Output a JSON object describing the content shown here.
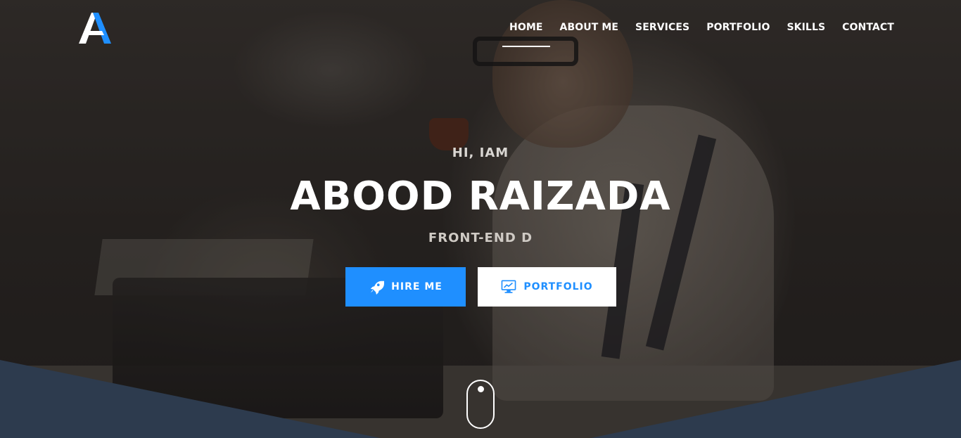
{
  "brand": {
    "logo_letter": "A",
    "logo_colors": {
      "light": "#ffffff",
      "accent": "#1f8fff"
    }
  },
  "nav": {
    "items": [
      {
        "label": "HOME",
        "active": true
      },
      {
        "label": "ABOUT ME",
        "active": false
      },
      {
        "label": "SERVICES",
        "active": false
      },
      {
        "label": "PORTFOLIO",
        "active": false
      },
      {
        "label": "SKILLS",
        "active": false
      },
      {
        "label": "CONTACT",
        "active": false
      }
    ]
  },
  "hero": {
    "greeting": "HI, IAM",
    "name": "ABOOD RAIZADA",
    "role": "FRONT-END D",
    "buttons": {
      "hire": {
        "label": "HIRE ME",
        "icon": "rocket-icon"
      },
      "portfolio": {
        "label": "PORTFOLIO",
        "icon": "monitor-chart-icon"
      }
    }
  },
  "scroll_indicator": {
    "icon": "mouse-scroll-icon"
  },
  "colors": {
    "accent": "#1f8fff",
    "bottom_panel": "#2d3b4e",
    "text": "#ffffff"
  }
}
